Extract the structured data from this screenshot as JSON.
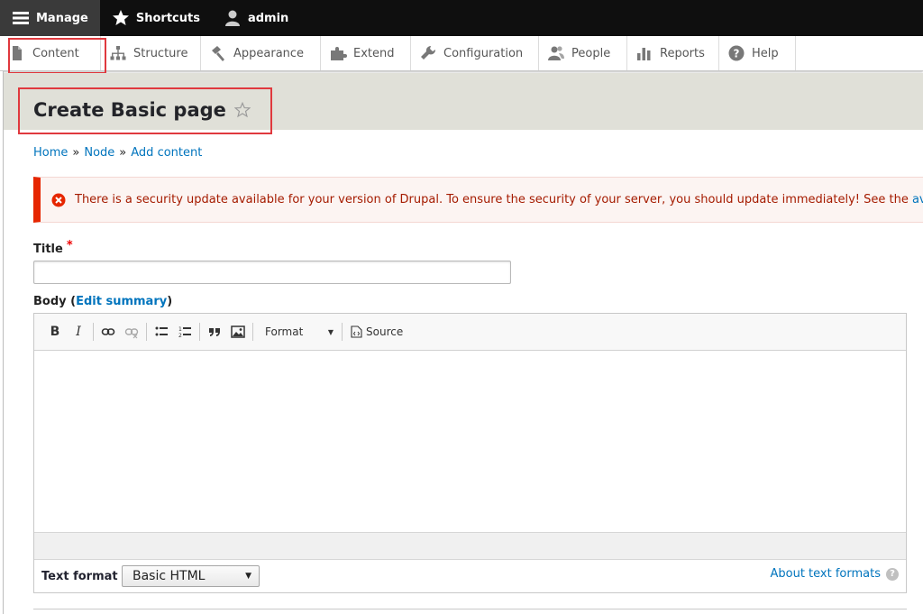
{
  "toolbar": {
    "manage": "Manage",
    "shortcuts": "Shortcuts",
    "user": "admin"
  },
  "tray": {
    "items": [
      {
        "label": "Content",
        "icon": "page-icon"
      },
      {
        "label": "Structure",
        "icon": "sitemap-icon"
      },
      {
        "label": "Appearance",
        "icon": "paintbrush-icon"
      },
      {
        "label": "Extend",
        "icon": "puzzle-icon"
      },
      {
        "label": "Configuration",
        "icon": "wrench-icon"
      },
      {
        "label": "People",
        "icon": "people-icon"
      },
      {
        "label": "Reports",
        "icon": "bar-chart-icon"
      },
      {
        "label": "Help",
        "icon": "help-icon"
      }
    ]
  },
  "page": {
    "title": "Create Basic page"
  },
  "breadcrumb": {
    "home": "Home",
    "sep": "»",
    "node": "Node",
    "add_content": "Add content"
  },
  "message": {
    "text": "There is a security update available for your version of Drupal. To ensure the security of your server, you should update immediately! See the ",
    "link": "av",
    "color": "#e62600"
  },
  "form": {
    "title_label": "Title",
    "required_mark": "*",
    "body_label": "Body (",
    "edit_summary": "Edit summary",
    "body_label_close": ")"
  },
  "editor": {
    "bold": "B",
    "italic": "I",
    "format_label": "Format",
    "source_label": "Source"
  },
  "text_format": {
    "label": "Text format",
    "selected": "Basic HTML",
    "about_link": "About text formats",
    "help": "?"
  },
  "colors": {
    "link": "#0074bd",
    "highlight": "#e0393e",
    "header_bg": "#e0e0d8"
  }
}
